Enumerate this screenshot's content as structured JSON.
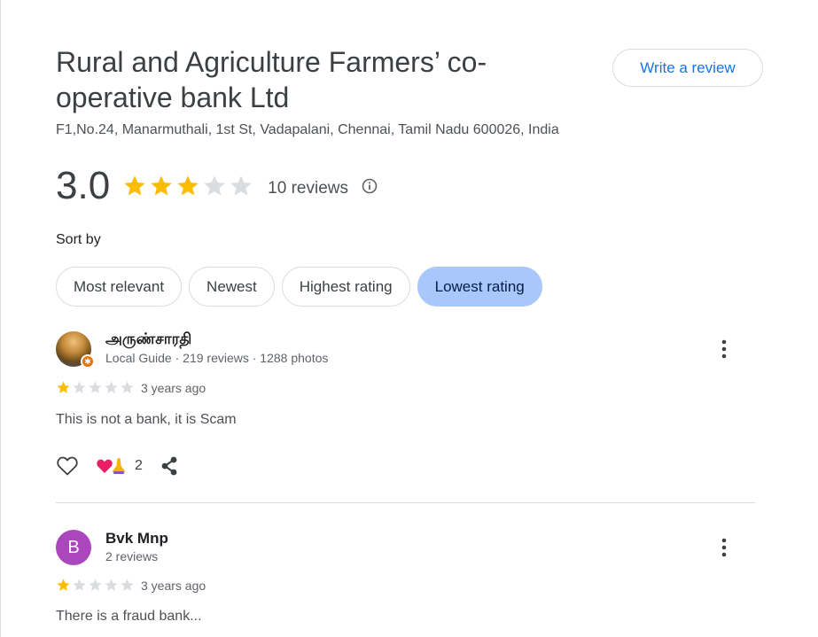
{
  "business": {
    "name": "Rural and Agriculture Farmers’ co-operative bank Ltd",
    "address": "F1,No.24, Manarmuthali, 1st St, Vadapalani, Chennai, Tamil Nadu 600026, India"
  },
  "write_review_label": "Write a review",
  "summary": {
    "rating": "3.0",
    "rating_value": 3,
    "reviews_count": "10 reviews"
  },
  "sort": {
    "label": "Sort by",
    "options": [
      "Most relevant",
      "Newest",
      "Highest rating",
      "Lowest rating"
    ],
    "selected": "Lowest rating"
  },
  "reviews": [
    {
      "name": "அருண்சாரதி",
      "meta": "Local Guide · 219 reviews · 1288 photos",
      "rating": 1,
      "time": "3 years ago",
      "text": "This is not a bank, it is Scam",
      "reaction_count": "2"
    },
    {
      "name": "Bvk Mnp",
      "avatar_letter": "B",
      "meta": "2 reviews",
      "rating": 1,
      "time": "3 years ago",
      "text": "There is a fraud bank..."
    }
  ],
  "colors": {
    "star_filled": "#fbbc04",
    "star_empty": "#dadce0",
    "accent_blue": "#1a73e8",
    "chip_selected": "#a8c7fa",
    "avatar_purple": "#ab47bc"
  },
  "icons": {
    "star": "star-icon",
    "info": "info-icon",
    "more": "more-vert-icon",
    "like": "heart-outline-icon",
    "share": "share-icon",
    "local_guide": "local-guide-badge-icon"
  }
}
